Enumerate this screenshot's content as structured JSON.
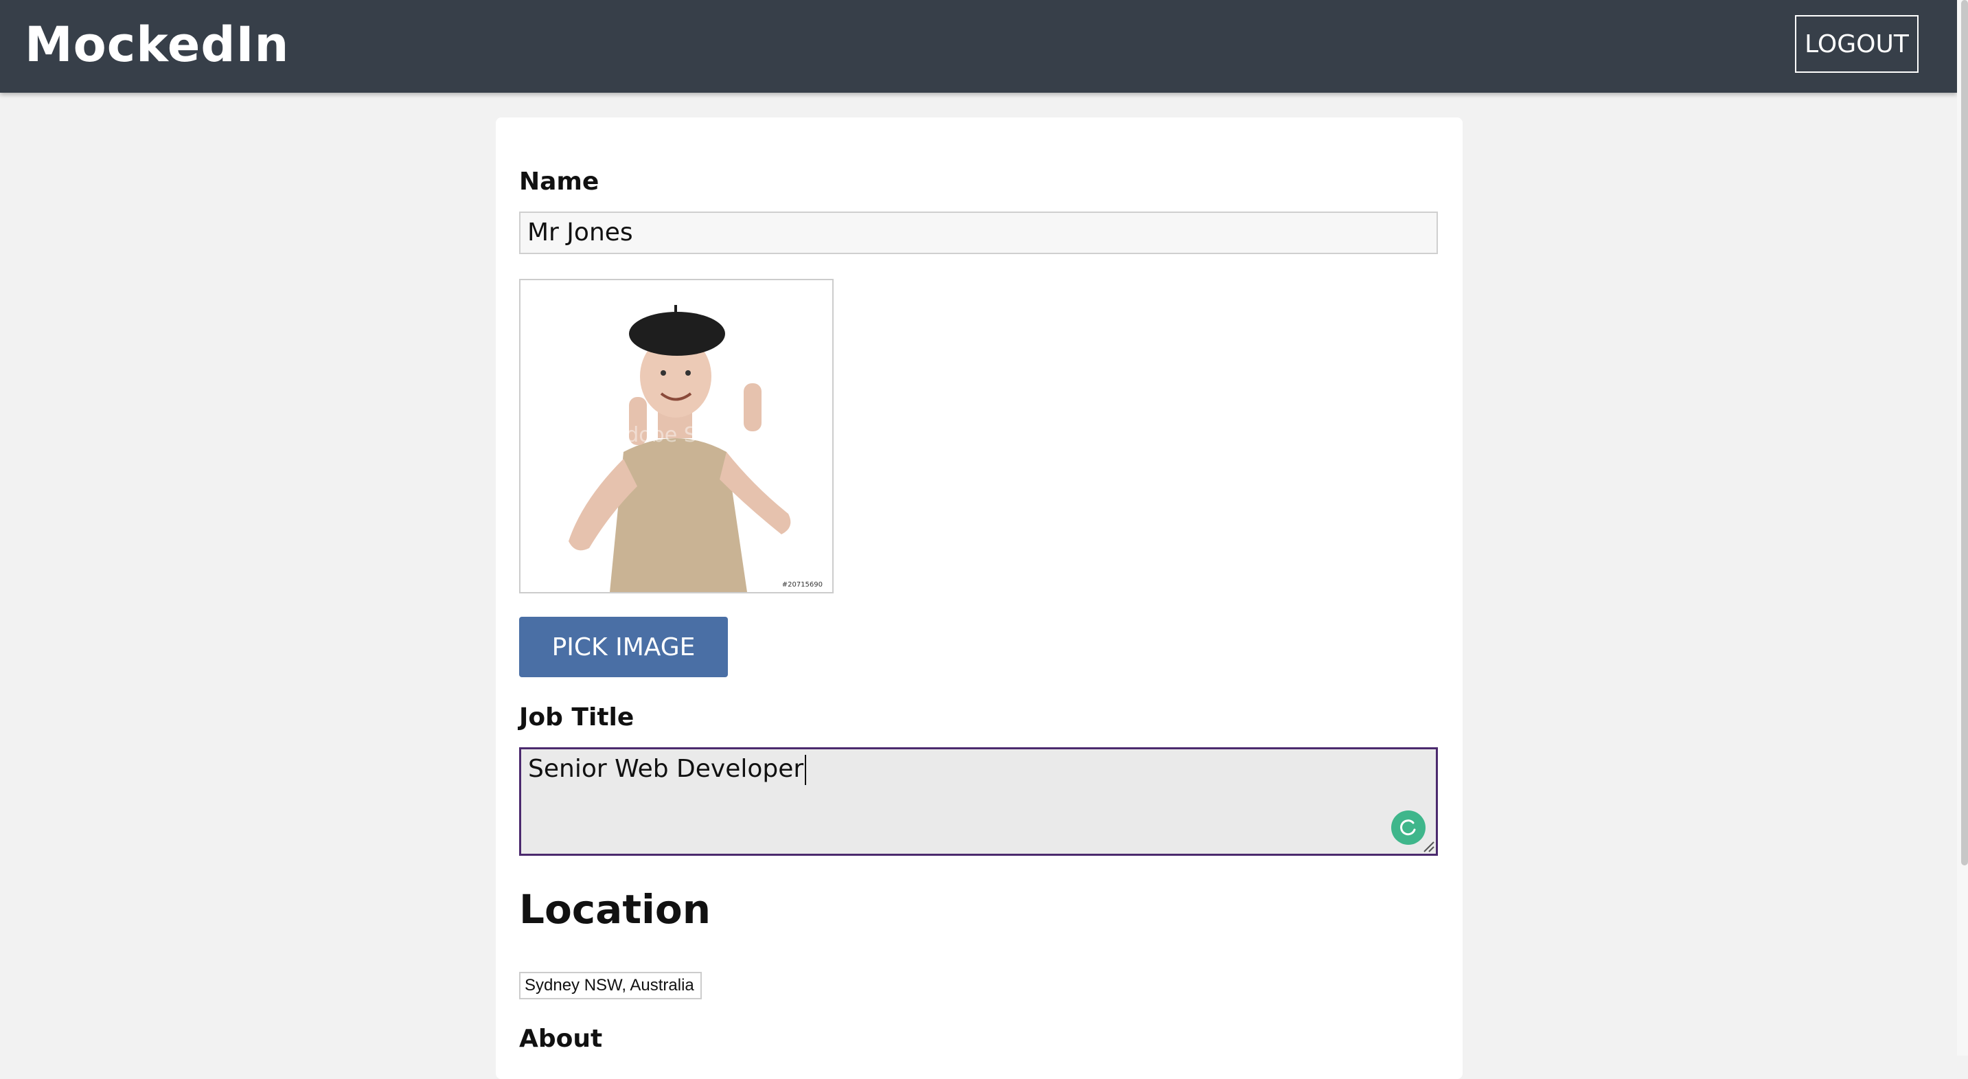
{
  "app": {
    "brand": "MockedIn",
    "logout_label": "LOGOUT"
  },
  "form": {
    "name_label": "Name",
    "name_value": "Mr Jones",
    "photo_alt": "Profile photo",
    "pick_image_label": "PICK IMAGE",
    "job_title_label": "Job Title",
    "job_title_value": "Senior Web Developer",
    "location_heading": "Location",
    "location_value": "Sydney NSW, Australia",
    "about_label": "About"
  },
  "colors": {
    "navbar": "#373f49",
    "button": "#4a6fa5",
    "focus_border": "#4b2a6e",
    "grammar_badge": "#3fb68b"
  }
}
